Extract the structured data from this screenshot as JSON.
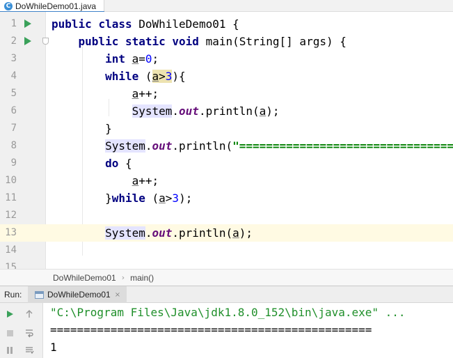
{
  "editor_tab": {
    "filename": "DoWhileDemo01.java",
    "icon": "C"
  },
  "editor": {
    "line_numbers": [
      "1",
      "2",
      "3",
      "4",
      "5",
      "6",
      "7",
      "8",
      "9",
      "10",
      "11",
      "12",
      "13",
      "14",
      "15"
    ],
    "code": {
      "l1": {
        "kw1": "public",
        "kw2": "class",
        "rest": " DoWhileDemo01 {"
      },
      "l2": {
        "kw1": "public",
        "kw2": "static",
        "kw3": "void",
        "rest": " main(String[] args) {"
      },
      "l3": {
        "kw": "int",
        "var": "a",
        "eq": "=",
        "num": "0",
        "end": ";"
      },
      "l4": {
        "kw": "while",
        "open": " (",
        "var": "a",
        "op": ">",
        "num": "3",
        "end": "){"
      },
      "l5": {
        "var": "a",
        "end": "++;"
      },
      "l6": {
        "cls": "System",
        "dot": ".",
        "field": "out",
        "call": ".println(",
        "var": "a",
        "end": ");"
      },
      "l7": {
        "text": "}"
      },
      "l8": {
        "cls": "System",
        "dot": ".",
        "field": "out",
        "call": ".println(",
        "str": "\"==================================="
      },
      "l9": {
        "kw": "do",
        "end": " {"
      },
      "l10": {
        "var": "a",
        "end": "++;"
      },
      "l11": {
        "brace": "}",
        "kw": "while",
        "open": " (",
        "var": "a",
        "op": ">",
        "num": "3",
        "end": ");"
      },
      "l12": {
        "text": ""
      },
      "l13": {
        "cls": "System",
        "dot": ".",
        "field": "out",
        "call": ".println(",
        "var": "a",
        "end": ");"
      }
    }
  },
  "breadcrumb": {
    "items": [
      "DoWhileDemo01",
      "main()"
    ],
    "separator": "›"
  },
  "run_panel": {
    "title": "Run:",
    "tab_label": "DoWhileDemo01",
    "tab_close": "×",
    "console_lines": [
      "\"C:\\Program Files\\Java\\jdk1.8.0_152\\bin\\java.exe\" ...",
      "================================================",
      "1"
    ],
    "tools": [
      "rerun-icon",
      "scroll-up-icon",
      "stop-icon",
      "soft-wrap-icon",
      "pause-icon",
      "scroll-to-end-icon"
    ]
  },
  "colors": {
    "keyword": "#000080",
    "number": "#0000ff",
    "string": "#008000",
    "static_field": "#660e7a",
    "run_icon": "#3aa15a",
    "current_line": "#fffae3",
    "console_command": "#1f8f2a"
  }
}
